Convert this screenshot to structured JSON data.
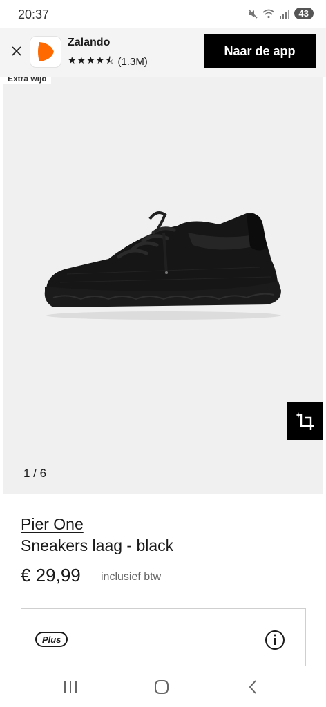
{
  "status_bar": {
    "time": "20:37",
    "battery_level": "43",
    "icons": [
      "mute-icon",
      "wifi-icon",
      "signal-icon"
    ]
  },
  "app_banner": {
    "app_name": "Zalando",
    "stars": "★★★★⯪",
    "review_count": "(1.3M)",
    "rating": 4.5,
    "cta_label": "Naar de app",
    "brand_color": "#ff6900"
  },
  "product_image": {
    "tag_label": "Extra wijd",
    "counter": "1 / 6",
    "background_color": "#f0f0f0"
  },
  "product": {
    "brand": "Pier One",
    "title": "Sneakers laag - black",
    "price": "€ 29,99",
    "vat_note": "inclusief btw"
  },
  "plus_section": {
    "badge_label": "Plus"
  },
  "nav_bar": {
    "buttons": [
      "recent-apps-icon",
      "home-icon",
      "back-icon"
    ]
  }
}
